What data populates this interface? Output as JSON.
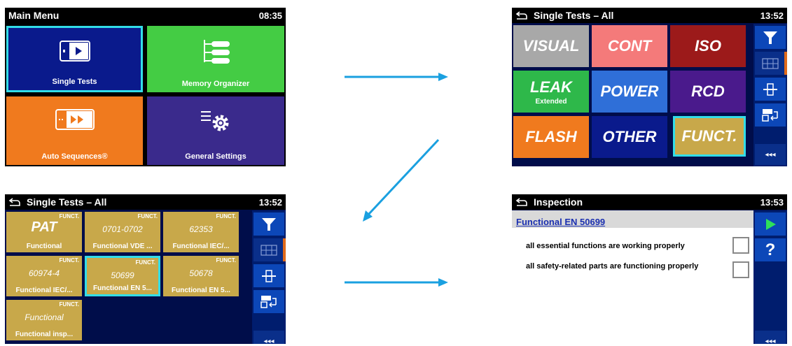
{
  "main_menu": {
    "title": "Main Menu",
    "time": "08:35",
    "tiles": [
      {
        "label": "Single Tests",
        "color": "#0a1a8c",
        "icon": "single-test-icon"
      },
      {
        "label": "Memory Organizer",
        "color": "#44cc44",
        "icon": "tree-icon"
      },
      {
        "label": "Auto Sequences®",
        "color": "#f07a1e",
        "icon": "sequence-icon"
      },
      {
        "label": "General Settings",
        "color": "#3a2a8c",
        "icon": "settings-gear-icon"
      }
    ]
  },
  "single_tests": {
    "title": "Single Tests – All",
    "time": "13:52",
    "tiles": [
      {
        "label": "VISUAL",
        "sub": "",
        "color": "#a8a8a8"
      },
      {
        "label": "CONT",
        "sub": "",
        "color": "#f47a7a"
      },
      {
        "label": "ISO",
        "sub": "",
        "color": "#9c1a1a"
      },
      {
        "label": "LEAK",
        "sub": "Extended",
        "color": "#2eb84a"
      },
      {
        "label": "POWER",
        "sub": "",
        "color": "#2f6fd8"
      },
      {
        "label": "RCD",
        "sub": "",
        "color": "#4a1a8c"
      },
      {
        "label": "FLASH",
        "sub": "",
        "color": "#f07a1e"
      },
      {
        "label": "OTHER",
        "sub": "",
        "color": "#0a1a8c"
      },
      {
        "label": "FUNCT.",
        "sub": "",
        "color": "#c8a84a"
      }
    ],
    "sidebar": {
      "more": "◂◂◂"
    }
  },
  "funct_tests": {
    "title": "Single Tests – All",
    "time": "13:52",
    "tiles": [
      {
        "tag": "FUNCT.",
        "name": "PAT",
        "desc": "Functional"
      },
      {
        "tag": "FUNCT.",
        "name": "0701-0702",
        "desc": "Functional VDE ..."
      },
      {
        "tag": "FUNCT.",
        "name": "62353",
        "desc": "Functional IEC/..."
      },
      {
        "tag": "FUNCT.",
        "name": "60974-4",
        "desc": "Functional IEC/..."
      },
      {
        "tag": "FUNCT.",
        "name": "50699",
        "desc": "Functional EN 5..."
      },
      {
        "tag": "FUNCT.",
        "name": "50678",
        "desc": "Functional EN 5..."
      },
      {
        "tag": "FUNCT.",
        "name": "Functional",
        "desc": "Functional insp..."
      }
    ],
    "sidebar": {
      "more": "◂◂◂"
    }
  },
  "inspection": {
    "title": "Inspection",
    "time": "13:53",
    "heading": "Functional EN 50699",
    "items": [
      "all essential functions are working properly",
      "all safety-related parts are functioning properly"
    ],
    "sidebar": {
      "help": "?",
      "more": "◂◂◂"
    }
  },
  "colors": {
    "arrow": "#1aa0e0",
    "highlight": "#33dde8"
  }
}
